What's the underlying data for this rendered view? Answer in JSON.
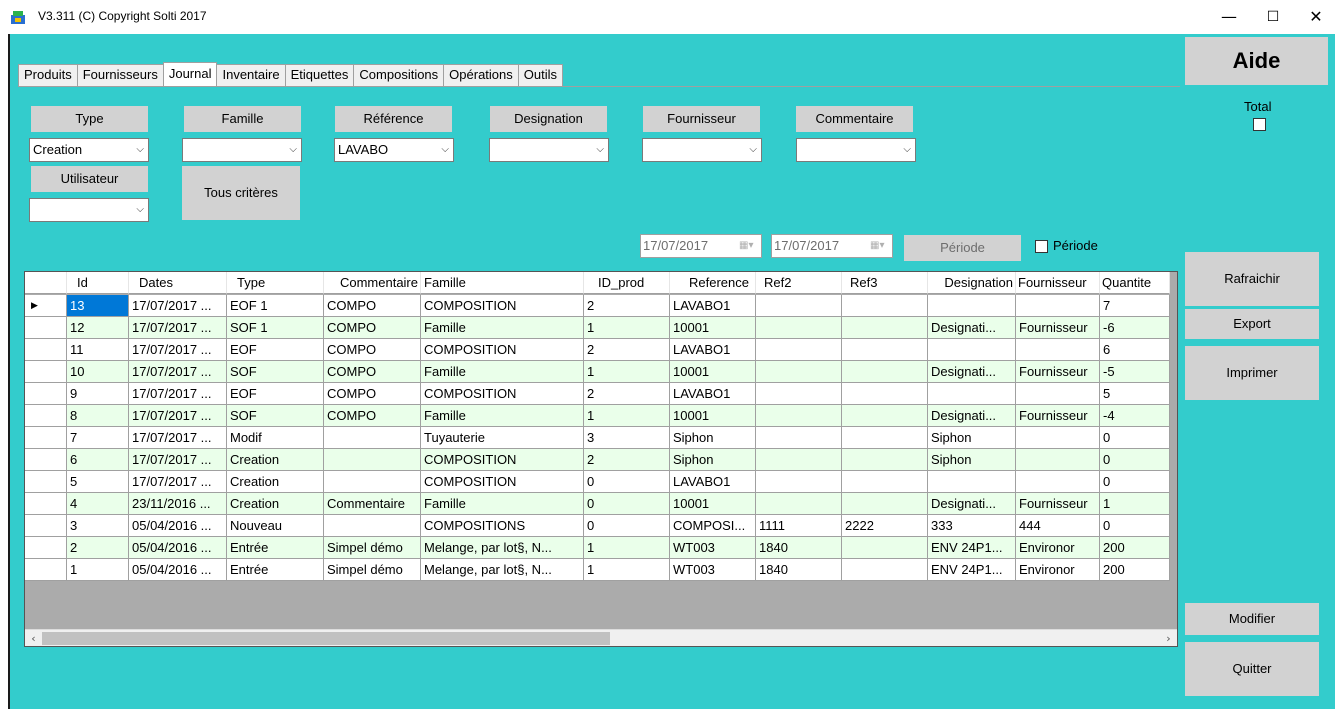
{
  "window": {
    "title": "V3.311 (C) Copyright Solti 2017",
    "minimize": "—",
    "maximize": "☐",
    "close": "✕"
  },
  "tabs": [
    {
      "label": "Produits"
    },
    {
      "label": "Fournisseurs"
    },
    {
      "label": "Journal",
      "active": true
    },
    {
      "label": "Inventaire"
    },
    {
      "label": "Etiquettes"
    },
    {
      "label": "Compositions"
    },
    {
      "label": "Opérations"
    },
    {
      "label": "Outils"
    }
  ],
  "aide_label": "Aide",
  "total_label": "Total",
  "filters": {
    "type": {
      "label": "Type",
      "value": "Creation"
    },
    "famille": {
      "label": "Famille",
      "value": ""
    },
    "reference": {
      "label": "Référence",
      "value": "LAVABO"
    },
    "designation": {
      "label": "Designation",
      "value": ""
    },
    "fournisseur": {
      "label": "Fournisseur",
      "value": ""
    },
    "commentaire": {
      "label": "Commentaire",
      "value": ""
    },
    "utilisateur": {
      "label": "Utilisateur",
      "value": ""
    },
    "tous_criteres": "Tous critères"
  },
  "period": {
    "date_from": "17/07/2017",
    "date_to": "17/07/2017",
    "button": "Période",
    "checkbox_label": "Période"
  },
  "side_buttons": {
    "rafraichir": "Rafraichir",
    "export": "Export",
    "imprimer": "Imprimer",
    "modifier": "Modifier",
    "quitter": "Quitter"
  },
  "grid": {
    "columns": [
      "Id",
      "Dates",
      "Type",
      "Commentaire",
      "Famille",
      "ID_prod",
      "Reference",
      "Ref2",
      "Ref3",
      "Designation",
      "Fournisseur",
      "Quantite"
    ],
    "rows": [
      [
        "13",
        "17/07/2017 ...",
        "EOF 1",
        "COMPO",
        "COMPOSITION",
        "2",
        "LAVABO1",
        "",
        "",
        "",
        "",
        "7"
      ],
      [
        "12",
        "17/07/2017 ...",
        "SOF 1",
        "COMPO",
        "Famille",
        "1",
        "10001",
        "",
        "",
        "Designati...",
        "Fournisseur",
        "-6"
      ],
      [
        "11",
        "17/07/2017 ...",
        "EOF",
        "COMPO",
        "COMPOSITION",
        "2",
        "LAVABO1",
        "",
        "",
        "",
        "",
        "6"
      ],
      [
        "10",
        "17/07/2017 ...",
        "SOF",
        "COMPO",
        "Famille",
        "1",
        "10001",
        "",
        "",
        "Designati...",
        "Fournisseur",
        "-5"
      ],
      [
        "9",
        "17/07/2017 ...",
        "EOF",
        "COMPO",
        "COMPOSITION",
        "2",
        "LAVABO1",
        "",
        "",
        "",
        "",
        "5"
      ],
      [
        "8",
        "17/07/2017 ...",
        "SOF",
        "COMPO",
        "Famille",
        "1",
        "10001",
        "",
        "",
        "Designati...",
        "Fournisseur",
        "-4"
      ],
      [
        "7",
        "17/07/2017 ...",
        "Modif",
        "",
        "Tuyauterie",
        "3",
        "Siphon",
        "",
        "",
        "Siphon",
        "",
        "0"
      ],
      [
        "6",
        "17/07/2017 ...",
        "Creation",
        "",
        "COMPOSITION",
        "2",
        "Siphon",
        "",
        "",
        "Siphon",
        "",
        "0"
      ],
      [
        "5",
        "17/07/2017 ...",
        "Creation",
        "",
        "COMPOSITION",
        "0",
        "LAVABO1",
        "",
        "",
        "",
        "",
        "0"
      ],
      [
        "4",
        "23/11/2016 ...",
        "Creation",
        "Commentaire",
        "Famille",
        "0",
        "10001",
        "",
        "",
        "Designati...",
        "Fournisseur",
        "1"
      ],
      [
        "3",
        "05/04/2016 ...",
        "Nouveau",
        "",
        "COMPOSITIONS",
        "0",
        "COMPOSI...",
        "1111",
        "2222",
        "333",
        "444",
        "0"
      ],
      [
        "2",
        "05/04/2016 ...",
        "Entrée",
        "Simpel démo",
        "Melange, par lot§, N...",
        "1",
        "WT003",
        "1840",
        "",
        "ENV 24P1...",
        "Environor",
        "200"
      ],
      [
        "1",
        "05/04/2016 ...",
        "Entrée",
        "Simpel démo",
        "Melange, par lot§, N...",
        "1",
        "WT003",
        "1840",
        "",
        "ENV 24P1...",
        "Environor",
        "200"
      ]
    ],
    "selected_row_marker": "▶"
  },
  "colors": {
    "background": "#33cccc",
    "button": "#d2d2d2",
    "row_alt": "#eaffea",
    "selection": "#0078d7"
  }
}
